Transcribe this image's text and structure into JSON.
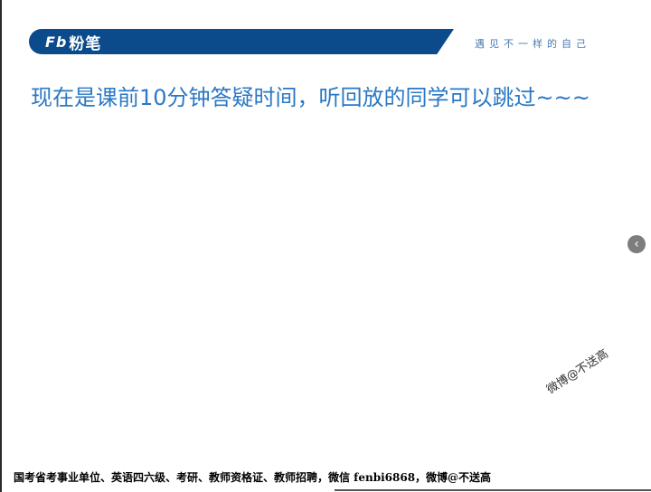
{
  "header": {
    "logo_mark": "Fb",
    "logo_text": "粉笔",
    "slogan": "遇见不一样的自己"
  },
  "slide": {
    "title": "现在是课前10分钟答疑时间，听回放的同学可以跳过~~~"
  },
  "nav": {
    "prev_icon": "‹"
  },
  "watermark": {
    "text": "微博@不送高"
  },
  "footer": {
    "text": "国考省考事业单位、英语四六级、考研、教师资格证、教师招聘，微信 fenbi6868，微博@不送高"
  },
  "colors": {
    "brand_blue": "#0b4a8b",
    "title_blue": "#2b78c4"
  }
}
